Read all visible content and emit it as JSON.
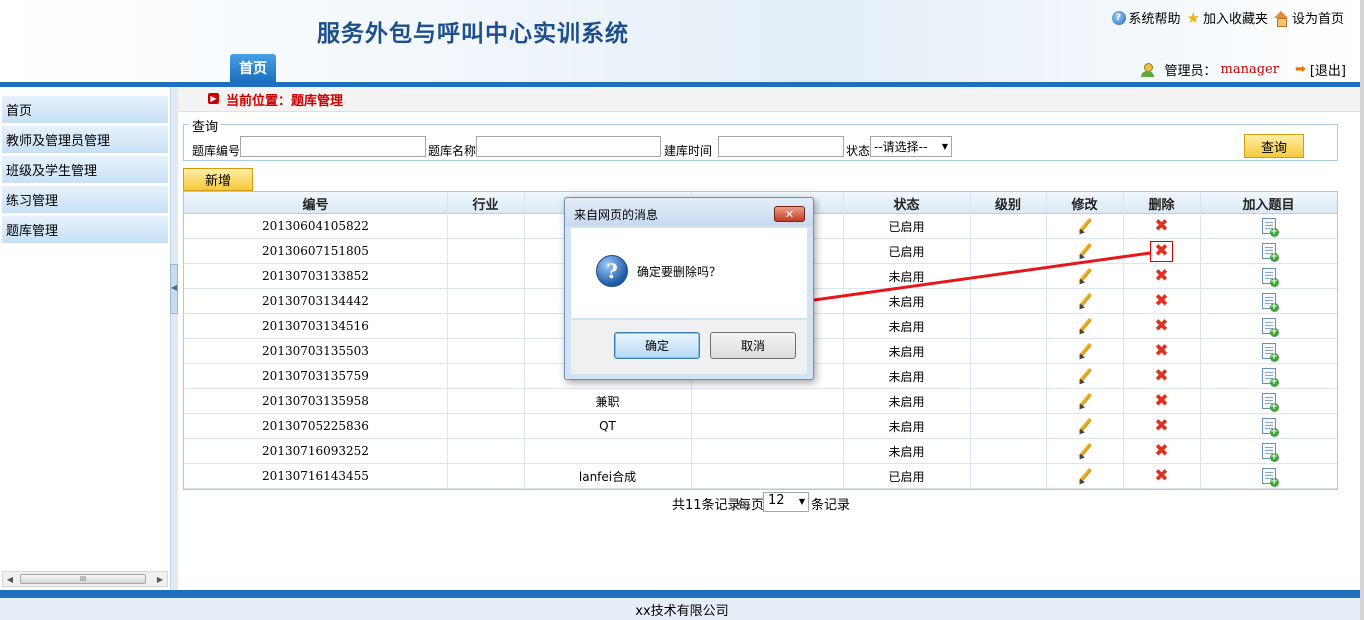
{
  "header": {
    "app_title": "服务外包与呼叫中心实训系统",
    "links": {
      "help": "系统帮助",
      "favorite": "加入收藏夹",
      "set_home": "设为首页"
    },
    "home_tab": "首页",
    "user_label": "管理员：",
    "user_name": "manager",
    "logout": "[退出]"
  },
  "sidebar": {
    "items": [
      {
        "label": "首页"
      },
      {
        "label": "教师及管理员管理"
      },
      {
        "label": "班级及学生管理"
      },
      {
        "label": "练习管理"
      },
      {
        "label": "题库管理"
      }
    ]
  },
  "breadcrumb": {
    "text": "当前位置：题库管理"
  },
  "query": {
    "legend": "查询",
    "id_label": "题库编号",
    "id_value": "",
    "name_label": "题库名称",
    "name_value": "",
    "time_label": "建库时间",
    "time_value": "",
    "status_label": "状态",
    "status_selected": "--请选择--",
    "search_button": "查询"
  },
  "add_button": "新增",
  "table": {
    "headers": [
      "编号",
      "行业",
      "",
      "",
      "状态",
      "级别",
      "修改",
      "删除",
      "加入题目"
    ],
    "rows": [
      {
        "id": "20130604105822",
        "industry": "",
        "name": "",
        "time": "",
        "status": "已启用",
        "level": ""
      },
      {
        "id": "20130607151805",
        "industry": "",
        "name": "",
        "time": "",
        "status": "已启用",
        "level": ""
      },
      {
        "id": "20130703133852",
        "industry": "",
        "name": "",
        "time": "",
        "status": "未启用",
        "level": ""
      },
      {
        "id": "20130703134442",
        "industry": "",
        "name": "",
        "time": "",
        "status": "未启用",
        "level": ""
      },
      {
        "id": "20130703134516",
        "industry": "",
        "name": "",
        "time": "",
        "status": "未启用",
        "level": ""
      },
      {
        "id": "20130703135503",
        "industry": "",
        "name": "",
        "time": "",
        "status": "未启用",
        "level": ""
      },
      {
        "id": "20130703135759",
        "industry": "",
        "name": "",
        "time": "",
        "status": "未启用",
        "level": ""
      },
      {
        "id": "20130703135958",
        "industry": "",
        "name": "兼职",
        "time": "",
        "status": "未启用",
        "level": ""
      },
      {
        "id": "20130705225836",
        "industry": "",
        "name": "QT",
        "time": "",
        "status": "未启用",
        "level": ""
      },
      {
        "id": "20130716093252",
        "industry": "",
        "name": "",
        "time": "",
        "status": "未启用",
        "level": ""
      },
      {
        "id": "20130716143455",
        "industry": "",
        "name": "lanfei合成",
        "time": "",
        "status": "已启用",
        "level": ""
      }
    ]
  },
  "pager": {
    "total_text": "共11条记录",
    "per_page_label": "每页",
    "per_page_value": "12",
    "unit": "条记录"
  },
  "footer": {
    "text": "xx技术有限公司"
  },
  "dialog": {
    "title": "来自网页的消息",
    "message": "确定要删除吗？",
    "ok": "确定",
    "cancel": "取消",
    "close_glyph": "✕"
  },
  "colors": {
    "brand_blue": "#1e6fc0",
    "title_blue": "#1d4f8c",
    "crumb_red": "#cc0000",
    "delete_red": "#e03020",
    "button_yellow": "#f5c93a"
  }
}
